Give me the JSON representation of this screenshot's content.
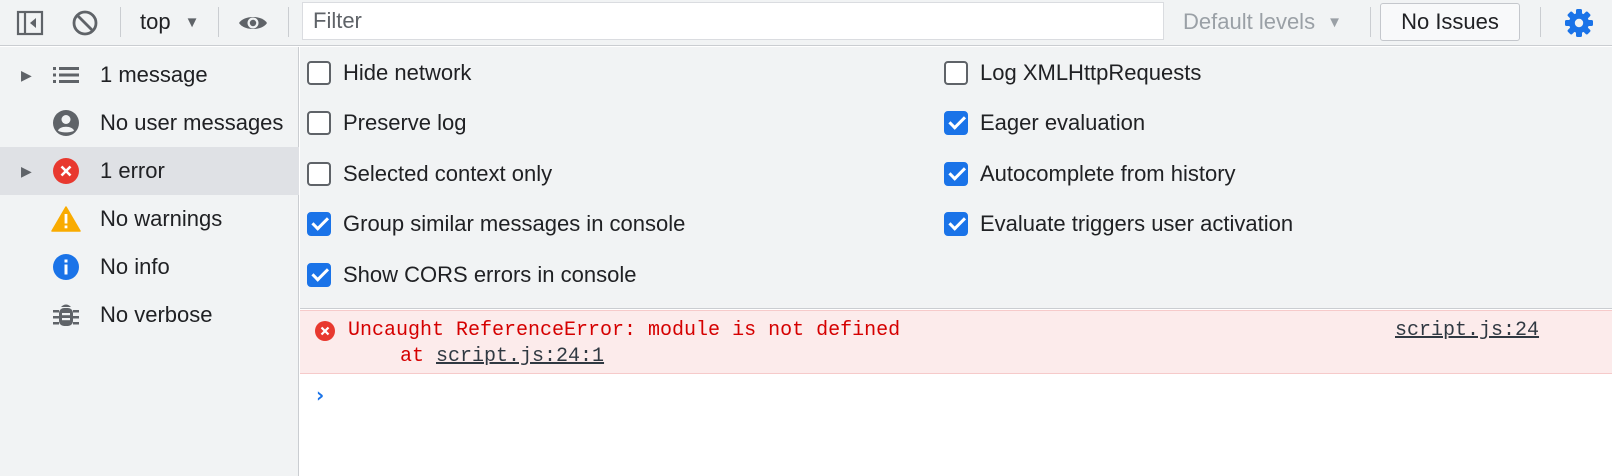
{
  "toolbar": {
    "sidebar_toggle_icon": "dock-sidebar-icon",
    "clear_icon": "block-icon",
    "context": "top",
    "eye_icon": "eye-icon",
    "filter_value": "",
    "filter_placeholder": "Filter",
    "levels": "Default levels",
    "issues": "No Issues",
    "settings_icon": "gear-icon"
  },
  "sidebar": {
    "items": [
      {
        "label": "1 message",
        "icon": "list-icon",
        "expandable": true
      },
      {
        "label": "No user messages",
        "icon": "user-icon",
        "expandable": false
      },
      {
        "label": "1 error",
        "icon": "error-icon",
        "expandable": true,
        "selected": true
      },
      {
        "label": "No warnings",
        "icon": "warning-icon",
        "expandable": false
      },
      {
        "label": "No info",
        "icon": "info-icon",
        "expandable": false
      },
      {
        "label": "No verbose",
        "icon": "bug-icon",
        "expandable": false
      }
    ]
  },
  "settings": {
    "left": [
      {
        "label": "Hide network",
        "checked": false
      },
      {
        "label": "Preserve log",
        "checked": false
      },
      {
        "label": "Selected context only",
        "checked": false
      },
      {
        "label": "Group similar messages in console",
        "checked": true
      },
      {
        "label": "Show CORS errors in console",
        "checked": true
      }
    ],
    "right": [
      {
        "label": "Log XMLHttpRequests",
        "checked": false
      },
      {
        "label": "Eager evaluation",
        "checked": true
      },
      {
        "label": "Autocomplete from history",
        "checked": true
      },
      {
        "label": "Evaluate triggers user activation",
        "checked": true
      }
    ]
  },
  "console": {
    "error_message": "Uncaught ReferenceError: module is not defined",
    "stack_prefix": "at ",
    "stack_link": "script.js:24:1",
    "source_link": "script.js:24",
    "prompt": "›"
  },
  "colors": {
    "accent": "#1a73e8",
    "error": "#d50000",
    "error_bg": "#fcebeb",
    "warning": "#f9ab00",
    "panel_bg": "#f1f3f4"
  }
}
